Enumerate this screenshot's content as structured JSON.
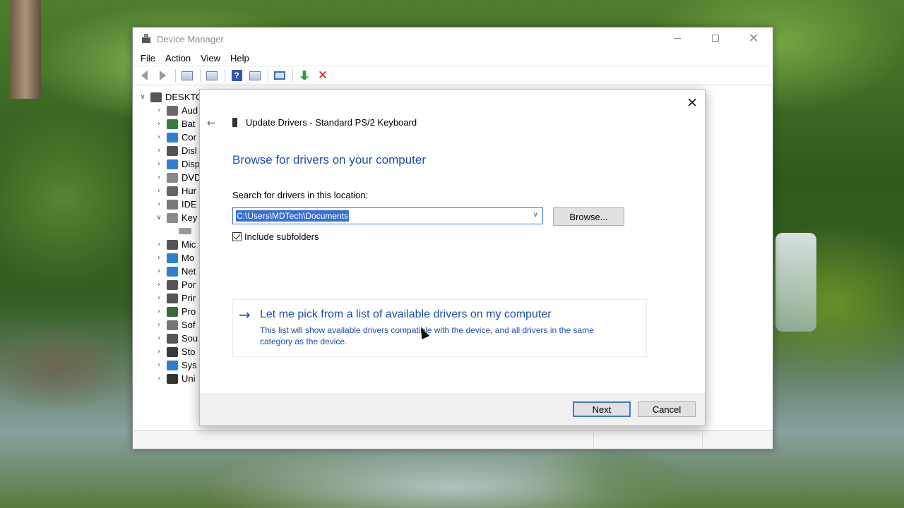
{
  "window": {
    "title": "Device Manager",
    "controls": {
      "minimize": "minimize",
      "maximize": "maximize",
      "close": "✕"
    }
  },
  "menu": [
    "File",
    "Action",
    "View",
    "Help"
  ],
  "toolbar_icons": [
    "back-icon",
    "forward-icon",
    "properties-icon",
    "show-hidden-icon",
    "help-icon",
    "view-icon",
    "scan-monitor-icon",
    "update-driver-icon",
    "uninstall-icon"
  ],
  "tree": {
    "root": "DESKTO",
    "items": [
      {
        "label": "Aud",
        "icon": "audio-icon",
        "color": "#6a6a6a",
        "expanded": false
      },
      {
        "label": "Bat",
        "icon": "battery-icon",
        "color": "#3a7a3a",
        "expanded": false
      },
      {
        "label": "Cor",
        "icon": "computer-icon",
        "color": "#2f7fd0",
        "expanded": false
      },
      {
        "label": "Disl",
        "icon": "disk-icon",
        "color": "#555555",
        "expanded": false
      },
      {
        "label": "Disp",
        "icon": "display-icon",
        "color": "#2f7fd0",
        "expanded": false
      },
      {
        "label": "DVD",
        "icon": "dvd-icon",
        "color": "#888888",
        "expanded": false
      },
      {
        "label": "Hur",
        "icon": "hid-icon",
        "color": "#666666",
        "expanded": false
      },
      {
        "label": "IDE",
        "icon": "ide-icon",
        "color": "#7a7a7a",
        "expanded": false
      },
      {
        "label": "Key",
        "icon": "keyboard-icon",
        "color": "#8a8a8a",
        "expanded": true
      },
      {
        "label": "",
        "icon": "keyboard-device-icon",
        "color": "#9a9a9a",
        "child": true
      },
      {
        "label": "Mic",
        "icon": "mouse-icon",
        "color": "#555555",
        "expanded": false
      },
      {
        "label": "Mo",
        "icon": "monitor-icon",
        "color": "#2f7fd0",
        "expanded": false
      },
      {
        "label": "Net",
        "icon": "network-icon",
        "color": "#2f7fd0",
        "expanded": false
      },
      {
        "label": "Por",
        "icon": "port-icon",
        "color": "#555555",
        "expanded": false
      },
      {
        "label": "Prir",
        "icon": "printer-icon",
        "color": "#555555",
        "expanded": false
      },
      {
        "label": "Pro",
        "icon": "processor-icon",
        "color": "#3a6a3a",
        "expanded": false
      },
      {
        "label": "Sof",
        "icon": "software-icon",
        "color": "#777777",
        "expanded": false
      },
      {
        "label": "Sou",
        "icon": "sound-icon",
        "color": "#555555",
        "expanded": false
      },
      {
        "label": "Sto",
        "icon": "storage-icon",
        "color": "#3a3a3a",
        "expanded": false
      },
      {
        "label": "Sys",
        "icon": "system-icon",
        "color": "#2f7fd0",
        "expanded": false
      },
      {
        "label": "Uni",
        "icon": "usb-icon",
        "color": "#333333",
        "expanded": false
      }
    ]
  },
  "dialog": {
    "close": "✕",
    "back": "←",
    "title": "Update Drivers - Standard PS/2 Keyboard",
    "heading": "Browse for drivers on your computer",
    "search_label": "Search for drivers in this location:",
    "path_value": "C:\\Users\\MDTech\\Documents",
    "browse_label": "Browse...",
    "include_subfolders_label": "Include subfolders",
    "include_subfolders_checked": true,
    "pick": {
      "arrow": "→",
      "title": "Let me pick from a list of available drivers on my computer",
      "description": "This list will show available drivers compatible with the device, and all drivers in the same category as the device."
    },
    "next_label": "Next",
    "cancel_label": "Cancel"
  },
  "colors": {
    "accent_blue": "#1c4fa3",
    "focus_blue": "#3b7bd4",
    "selection_blue": "#3b6fd0"
  }
}
